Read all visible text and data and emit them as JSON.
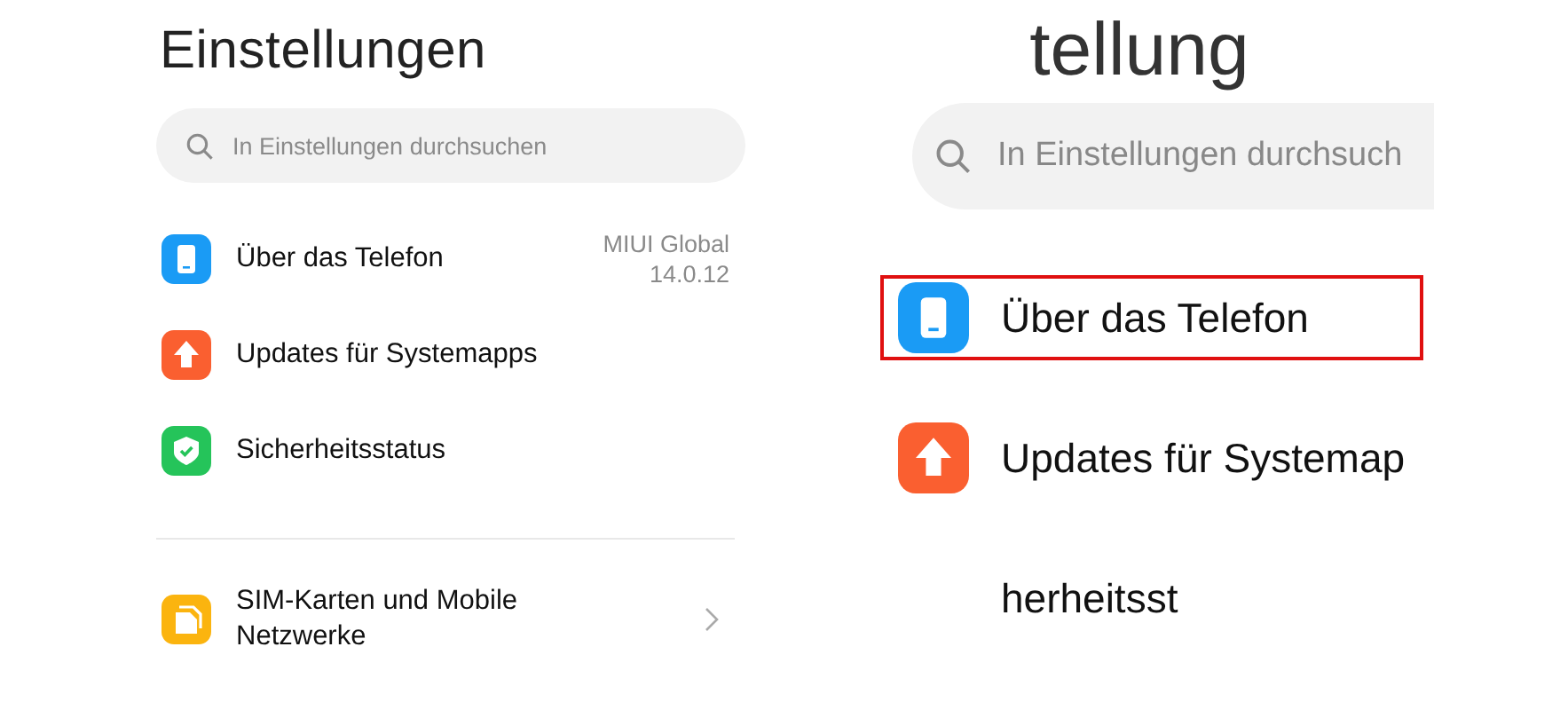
{
  "title": "Einstellungen",
  "search": {
    "placeholder": "In Einstellungen durchsuchen"
  },
  "groups": [
    {
      "items": [
        {
          "label": "Über das Telefon",
          "color": "#1a9bf5",
          "detail": "MIUI Global 14.0.12",
          "chevron": false
        },
        {
          "label": "Updates für Systemapps",
          "color": "#fa5f30",
          "chevron": false
        },
        {
          "label": "Sicherheitsstatus",
          "color": "#25c45a",
          "chevron": false
        }
      ]
    },
    {
      "items": [
        {
          "label": "SIM-Karten und Mobile Netzwerke",
          "color": "#fbb40f",
          "chevron": true
        }
      ]
    }
  ],
  "magnifier": {
    "title_fragment": "tellung",
    "search_placeholder": "In Einstellungen durchsuch",
    "items": [
      {
        "label": "Über das Telefon",
        "color": "#1a9bf5",
        "highlighted": true
      },
      {
        "label": "Updates für Systemap",
        "color": "#fa5f30",
        "highlighted": false
      },
      {
        "label": "herheitsst",
        "highlighted": false
      }
    ]
  }
}
